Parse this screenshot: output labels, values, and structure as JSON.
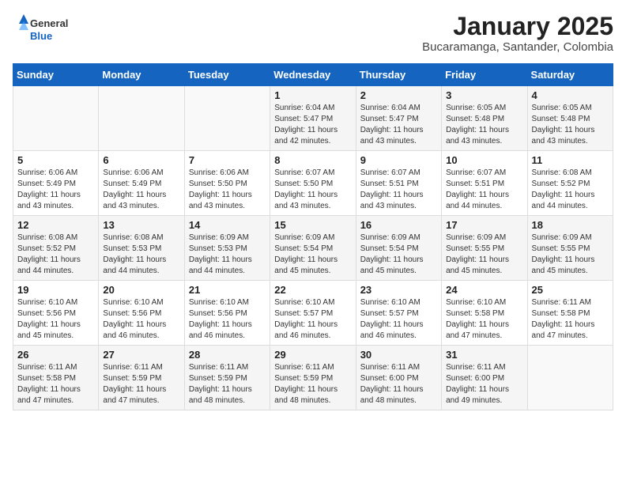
{
  "header": {
    "logo_general": "General",
    "logo_blue": "Blue",
    "month": "January 2025",
    "location": "Bucaramanga, Santander, Colombia"
  },
  "weekdays": [
    "Sunday",
    "Monday",
    "Tuesday",
    "Wednesday",
    "Thursday",
    "Friday",
    "Saturday"
  ],
  "weeks": [
    [
      {
        "day": "",
        "info": ""
      },
      {
        "day": "",
        "info": ""
      },
      {
        "day": "",
        "info": ""
      },
      {
        "day": "1",
        "info": "Sunrise: 6:04 AM\nSunset: 5:47 PM\nDaylight: 11 hours\nand 42 minutes."
      },
      {
        "day": "2",
        "info": "Sunrise: 6:04 AM\nSunset: 5:47 PM\nDaylight: 11 hours\nand 43 minutes."
      },
      {
        "day": "3",
        "info": "Sunrise: 6:05 AM\nSunset: 5:48 PM\nDaylight: 11 hours\nand 43 minutes."
      },
      {
        "day": "4",
        "info": "Sunrise: 6:05 AM\nSunset: 5:48 PM\nDaylight: 11 hours\nand 43 minutes."
      }
    ],
    [
      {
        "day": "5",
        "info": "Sunrise: 6:06 AM\nSunset: 5:49 PM\nDaylight: 11 hours\nand 43 minutes."
      },
      {
        "day": "6",
        "info": "Sunrise: 6:06 AM\nSunset: 5:49 PM\nDaylight: 11 hours\nand 43 minutes."
      },
      {
        "day": "7",
        "info": "Sunrise: 6:06 AM\nSunset: 5:50 PM\nDaylight: 11 hours\nand 43 minutes."
      },
      {
        "day": "8",
        "info": "Sunrise: 6:07 AM\nSunset: 5:50 PM\nDaylight: 11 hours\nand 43 minutes."
      },
      {
        "day": "9",
        "info": "Sunrise: 6:07 AM\nSunset: 5:51 PM\nDaylight: 11 hours\nand 43 minutes."
      },
      {
        "day": "10",
        "info": "Sunrise: 6:07 AM\nSunset: 5:51 PM\nDaylight: 11 hours\nand 44 minutes."
      },
      {
        "day": "11",
        "info": "Sunrise: 6:08 AM\nSunset: 5:52 PM\nDaylight: 11 hours\nand 44 minutes."
      }
    ],
    [
      {
        "day": "12",
        "info": "Sunrise: 6:08 AM\nSunset: 5:52 PM\nDaylight: 11 hours\nand 44 minutes."
      },
      {
        "day": "13",
        "info": "Sunrise: 6:08 AM\nSunset: 5:53 PM\nDaylight: 11 hours\nand 44 minutes."
      },
      {
        "day": "14",
        "info": "Sunrise: 6:09 AM\nSunset: 5:53 PM\nDaylight: 11 hours\nand 44 minutes."
      },
      {
        "day": "15",
        "info": "Sunrise: 6:09 AM\nSunset: 5:54 PM\nDaylight: 11 hours\nand 45 minutes."
      },
      {
        "day": "16",
        "info": "Sunrise: 6:09 AM\nSunset: 5:54 PM\nDaylight: 11 hours\nand 45 minutes."
      },
      {
        "day": "17",
        "info": "Sunrise: 6:09 AM\nSunset: 5:55 PM\nDaylight: 11 hours\nand 45 minutes."
      },
      {
        "day": "18",
        "info": "Sunrise: 6:09 AM\nSunset: 5:55 PM\nDaylight: 11 hours\nand 45 minutes."
      }
    ],
    [
      {
        "day": "19",
        "info": "Sunrise: 6:10 AM\nSunset: 5:56 PM\nDaylight: 11 hours\nand 45 minutes."
      },
      {
        "day": "20",
        "info": "Sunrise: 6:10 AM\nSunset: 5:56 PM\nDaylight: 11 hours\nand 46 minutes."
      },
      {
        "day": "21",
        "info": "Sunrise: 6:10 AM\nSunset: 5:56 PM\nDaylight: 11 hours\nand 46 minutes."
      },
      {
        "day": "22",
        "info": "Sunrise: 6:10 AM\nSunset: 5:57 PM\nDaylight: 11 hours\nand 46 minutes."
      },
      {
        "day": "23",
        "info": "Sunrise: 6:10 AM\nSunset: 5:57 PM\nDaylight: 11 hours\nand 46 minutes."
      },
      {
        "day": "24",
        "info": "Sunrise: 6:10 AM\nSunset: 5:58 PM\nDaylight: 11 hours\nand 47 minutes."
      },
      {
        "day": "25",
        "info": "Sunrise: 6:11 AM\nSunset: 5:58 PM\nDaylight: 11 hours\nand 47 minutes."
      }
    ],
    [
      {
        "day": "26",
        "info": "Sunrise: 6:11 AM\nSunset: 5:58 PM\nDaylight: 11 hours\nand 47 minutes."
      },
      {
        "day": "27",
        "info": "Sunrise: 6:11 AM\nSunset: 5:59 PM\nDaylight: 11 hours\nand 47 minutes."
      },
      {
        "day": "28",
        "info": "Sunrise: 6:11 AM\nSunset: 5:59 PM\nDaylight: 11 hours\nand 48 minutes."
      },
      {
        "day": "29",
        "info": "Sunrise: 6:11 AM\nSunset: 5:59 PM\nDaylight: 11 hours\nand 48 minutes."
      },
      {
        "day": "30",
        "info": "Sunrise: 6:11 AM\nSunset: 6:00 PM\nDaylight: 11 hours\nand 48 minutes."
      },
      {
        "day": "31",
        "info": "Sunrise: 6:11 AM\nSunset: 6:00 PM\nDaylight: 11 hours\nand 49 minutes."
      },
      {
        "day": "",
        "info": ""
      }
    ]
  ]
}
